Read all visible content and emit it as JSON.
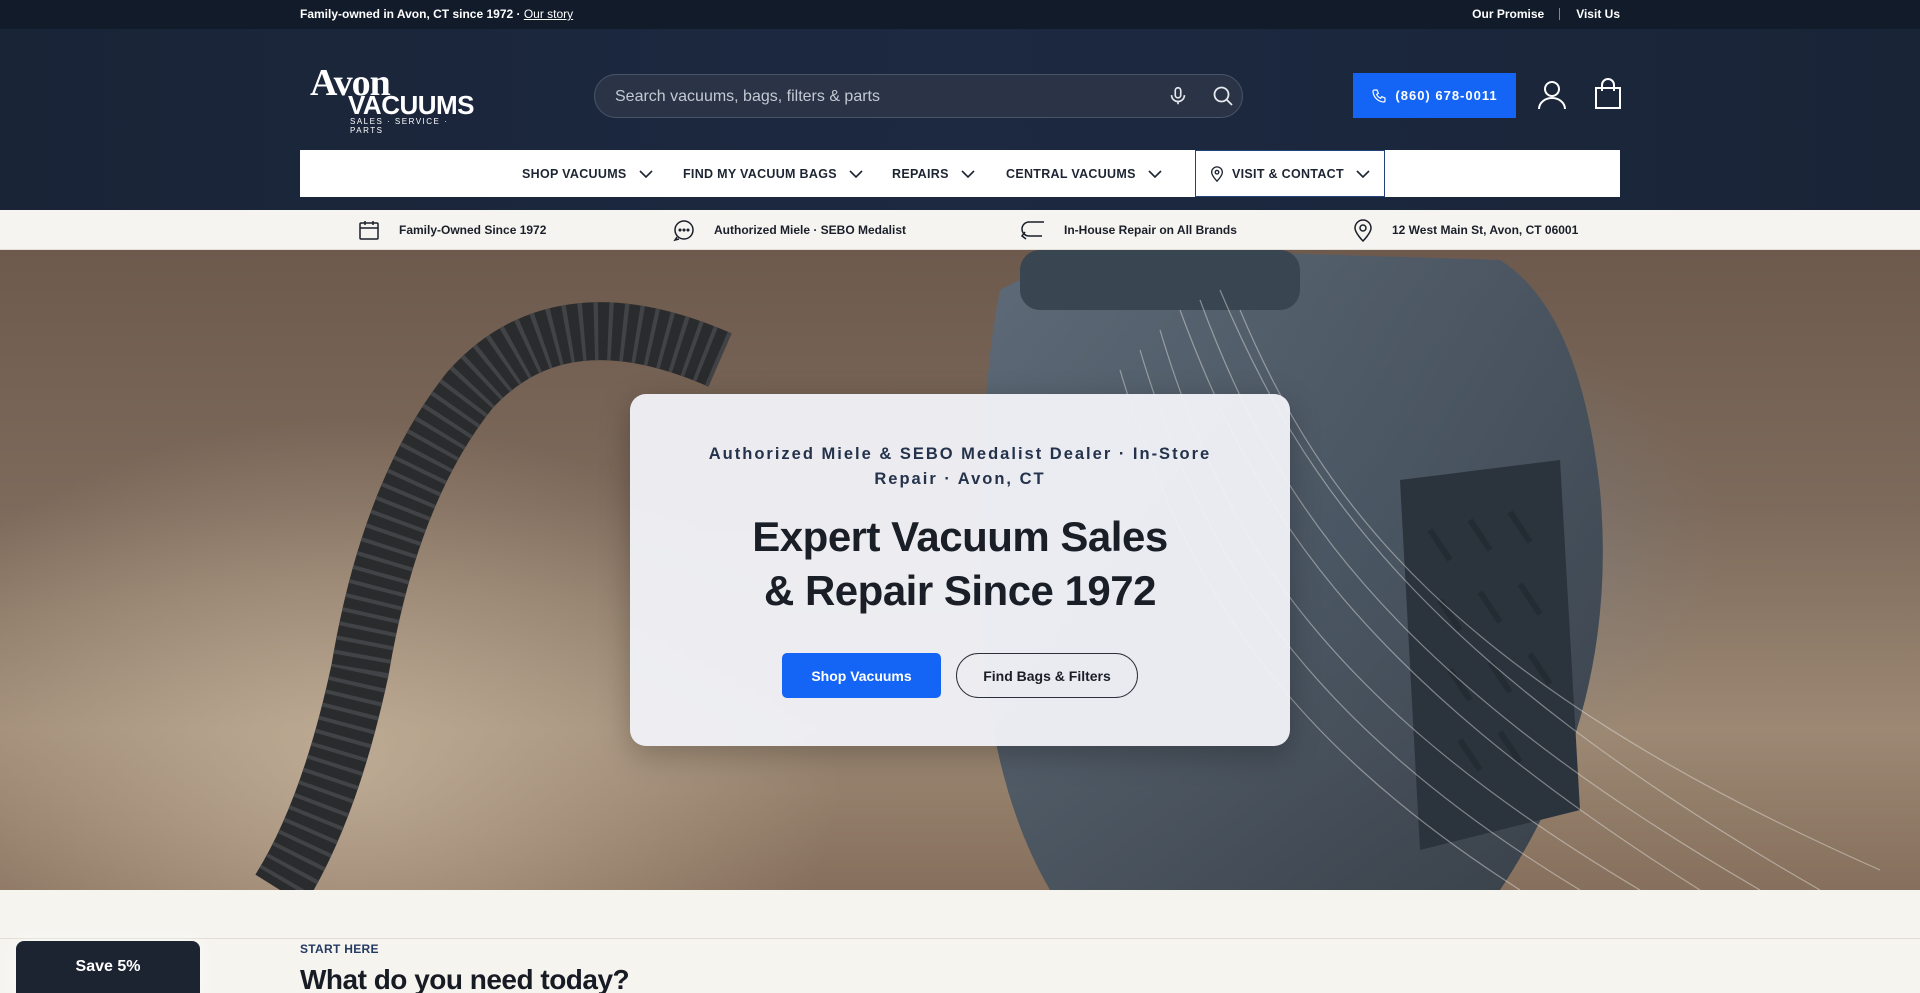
{
  "announcement": {
    "left_text": "Family-owned in Avon, CT since 1972 · ",
    "left_link": "Our story",
    "right_links": [
      "Our Promise",
      "Visit Us"
    ]
  },
  "header": {
    "logo": {
      "line1": "Avon",
      "line2": "VACUUMS",
      "tagline": "SALES · SERVICE · PARTS"
    },
    "search_placeholder": "Search vacuums, bags, filters & parts",
    "phone_label": "(860) 678-0011",
    "icons": [
      "microphone-icon",
      "search-icon",
      "phone-icon",
      "account-icon",
      "bag-icon"
    ]
  },
  "nav": {
    "items": [
      {
        "label": "SHOP VACUUMS"
      },
      {
        "label": "FIND MY VACUUM BAGS"
      },
      {
        "label": "REPAIRS"
      },
      {
        "label": "CENTRAL VACUUMS"
      },
      {
        "label": "VISIT & CONTACT"
      }
    ]
  },
  "trust": {
    "items": [
      {
        "icon": "calendar-icon",
        "label": "Family-Owned Since 1972"
      },
      {
        "icon": "chat-bubble-icon",
        "label": "Authorized Miele · SEBO Medalist"
      },
      {
        "icon": "return-arrow-icon",
        "label": "In-House Repair on All Brands"
      },
      {
        "icon": "location-pin-icon",
        "label": "12 West Main St, Avon, CT 06001"
      }
    ]
  },
  "hero": {
    "eyebrow": "Authorized Miele & SEBO Medalist Dealer · In-Store Repair · Avon, CT",
    "title_line1": "Expert Vacuum Sales",
    "title_line2": "& Repair Since 1972",
    "primary_cta": "Shop Vacuums",
    "secondary_cta": "Find Bags & Filters"
  },
  "section": {
    "kicker": "START HERE",
    "title": "What do you need today?"
  },
  "promo": {
    "label": "Save 5%"
  },
  "colors": {
    "accent": "#1464f5",
    "header_bg": "#1a2437",
    "announce_bg": "#121b2a"
  }
}
